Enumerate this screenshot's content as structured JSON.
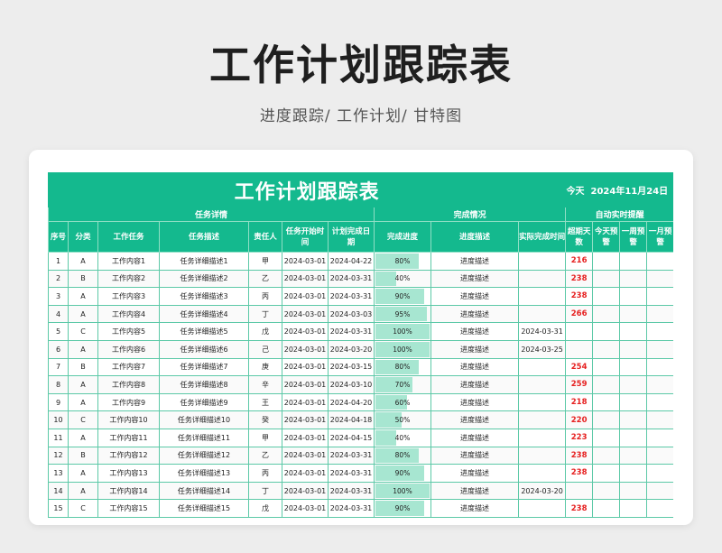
{
  "page": {
    "title": "工作计划跟踪表",
    "subtitle": "进度跟踪/  工作计划/  甘特图"
  },
  "sheet": {
    "title": "工作计划跟踪表",
    "today_label": "今天",
    "today_date": "2024年11月24日",
    "groups": {
      "task": "任务详情",
      "done": "完成情况",
      "remind": "自动实时提醒"
    },
    "headers": {
      "no": "序号",
      "category": "分类",
      "task": "工作任务",
      "desc": "任务描述",
      "owner": "责任人",
      "start": "任务开始时间",
      "plan_end": "计划完成日期",
      "progress": "完成进度",
      "progress_desc": "进度描述",
      "actual_end": "实际完成时间",
      "overdue": "超期天数",
      "today": "今天预警",
      "week": "一周预警",
      "month": "一月预警"
    },
    "rows": [
      {
        "no": "1",
        "cat": "A",
        "task": "工作内容1",
        "desc": "任务详细描述1",
        "owner": "甲",
        "start": "2024-03-01",
        "end": "2024-04-22",
        "progress": "80%",
        "pct": 0.8,
        "pdesc": "进度描述",
        "actual": "",
        "overdue": "216"
      },
      {
        "no": "2",
        "cat": "B",
        "task": "工作内容2",
        "desc": "任务详细描述2",
        "owner": "乙",
        "start": "2024-03-01",
        "end": "2024-03-31",
        "progress": "40%",
        "pct": 0.4,
        "pdesc": "进度描述",
        "actual": "",
        "overdue": "238"
      },
      {
        "no": "3",
        "cat": "A",
        "task": "工作内容3",
        "desc": "任务详细描述3",
        "owner": "丙",
        "start": "2024-03-01",
        "end": "2024-03-31",
        "progress": "90%",
        "pct": 0.9,
        "pdesc": "进度描述",
        "actual": "",
        "overdue": "238"
      },
      {
        "no": "4",
        "cat": "A",
        "task": "工作内容4",
        "desc": "任务详细描述4",
        "owner": "丁",
        "start": "2024-03-01",
        "end": "2024-03-03",
        "progress": "95%",
        "pct": 0.95,
        "pdesc": "进度描述",
        "actual": "",
        "overdue": "266"
      },
      {
        "no": "5",
        "cat": "C",
        "task": "工作内容5",
        "desc": "任务详细描述5",
        "owner": "戊",
        "start": "2024-03-01",
        "end": "2024-03-31",
        "progress": "100%",
        "pct": 1.0,
        "pdesc": "进度描述",
        "actual": "2024-03-31",
        "overdue": ""
      },
      {
        "no": "6",
        "cat": "A",
        "task": "工作内容6",
        "desc": "任务详细描述6",
        "owner": "己",
        "start": "2024-03-01",
        "end": "2024-03-20",
        "progress": "100%",
        "pct": 1.0,
        "pdesc": "进度描述",
        "actual": "2024-03-25",
        "overdue": ""
      },
      {
        "no": "7",
        "cat": "B",
        "task": "工作内容7",
        "desc": "任务详细描述7",
        "owner": "庚",
        "start": "2024-03-01",
        "end": "2024-03-15",
        "progress": "80%",
        "pct": 0.8,
        "pdesc": "进度描述",
        "actual": "",
        "overdue": "254"
      },
      {
        "no": "8",
        "cat": "A",
        "task": "工作内容8",
        "desc": "任务详细描述8",
        "owner": "辛",
        "start": "2024-03-01",
        "end": "2024-03-10",
        "progress": "70%",
        "pct": 0.7,
        "pdesc": "进度描述",
        "actual": "",
        "overdue": "259"
      },
      {
        "no": "9",
        "cat": "A",
        "task": "工作内容9",
        "desc": "任务详细描述9",
        "owner": "王",
        "start": "2024-03-01",
        "end": "2024-04-20",
        "progress": "60%",
        "pct": 0.6,
        "pdesc": "进度描述",
        "actual": "",
        "overdue": "218"
      },
      {
        "no": "10",
        "cat": "C",
        "task": "工作内容10",
        "desc": "任务详细描述10",
        "owner": "癸",
        "start": "2024-03-01",
        "end": "2024-04-18",
        "progress": "50%",
        "pct": 0.5,
        "pdesc": "进度描述",
        "actual": "",
        "overdue": "220"
      },
      {
        "no": "11",
        "cat": "A",
        "task": "工作内容11",
        "desc": "任务详细描述11",
        "owner": "甲",
        "start": "2024-03-01",
        "end": "2024-04-15",
        "progress": "40%",
        "pct": 0.4,
        "pdesc": "进度描述",
        "actual": "",
        "overdue": "223"
      },
      {
        "no": "12",
        "cat": "B",
        "task": "工作内容12",
        "desc": "任务详细描述12",
        "owner": "乙",
        "start": "2024-03-01",
        "end": "2024-03-31",
        "progress": "80%",
        "pct": 0.8,
        "pdesc": "进度描述",
        "actual": "",
        "overdue": "238"
      },
      {
        "no": "13",
        "cat": "A",
        "task": "工作内容13",
        "desc": "任务详细描述13",
        "owner": "丙",
        "start": "2024-03-01",
        "end": "2024-03-31",
        "progress": "90%",
        "pct": 0.9,
        "pdesc": "进度描述",
        "actual": "",
        "overdue": "238"
      },
      {
        "no": "14",
        "cat": "A",
        "task": "工作内容14",
        "desc": "任务详细描述14",
        "owner": "丁",
        "start": "2024-03-01",
        "end": "2024-03-31",
        "progress": "100%",
        "pct": 1.0,
        "pdesc": "进度描述",
        "actual": "2024-03-20",
        "overdue": ""
      },
      {
        "no": "15",
        "cat": "C",
        "task": "工作内容15",
        "desc": "任务详细描述15",
        "owner": "戊",
        "start": "2024-03-01",
        "end": "2024-03-31",
        "progress": "90%",
        "pct": 0.9,
        "pdesc": "进度描述",
        "actual": "",
        "overdue": "238"
      }
    ]
  }
}
